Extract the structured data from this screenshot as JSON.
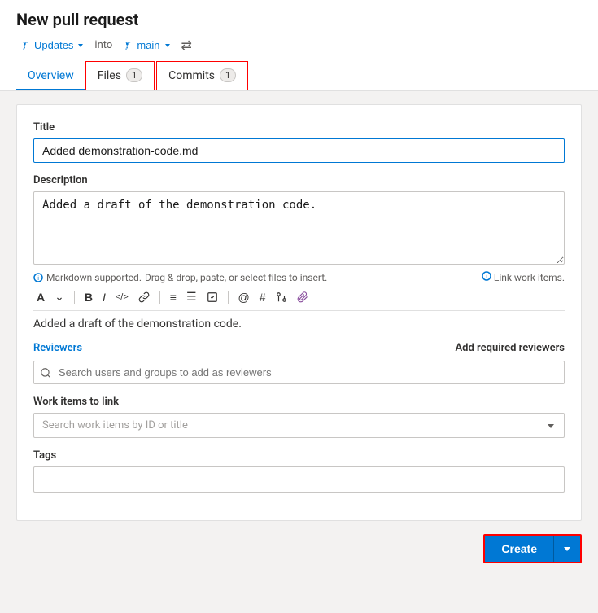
{
  "page": {
    "title": "New pull request"
  },
  "branch_row": {
    "source_icon": "branch-icon",
    "source_label": "Updates",
    "into_text": "into",
    "target_icon": "branch-icon",
    "target_label": "main",
    "swap_label": "⇄"
  },
  "tabs": [
    {
      "id": "overview",
      "label": "Overview",
      "badge": null,
      "active": true,
      "highlighted": false
    },
    {
      "id": "files",
      "label": "Files",
      "badge": "1",
      "active": false,
      "highlighted": true
    },
    {
      "id": "commits",
      "label": "Commits",
      "badge": "1",
      "active": false,
      "highlighted": true
    }
  ],
  "form": {
    "title_label": "Title",
    "title_value": "Added demonstration-code.md",
    "description_label": "Description",
    "description_value": "Added a draft of the demonstration code.",
    "markdown_hint": "Markdown supported.",
    "drag_hint": "Drag & drop, paste, or select files to insert.",
    "link_work_items": "Link work items.",
    "toolbar_buttons": [
      {
        "id": "format",
        "label": "A",
        "title": "Format"
      },
      {
        "id": "chevron",
        "label": "⌄",
        "title": "More"
      },
      {
        "id": "bold",
        "label": "B",
        "title": "Bold"
      },
      {
        "id": "italic",
        "label": "I",
        "title": "Italic"
      },
      {
        "id": "code",
        "label": "</>",
        "title": "Code"
      },
      {
        "id": "link",
        "label": "🔗",
        "title": "Link"
      },
      {
        "id": "ordered-list",
        "label": "≡",
        "title": "Ordered list"
      },
      {
        "id": "unordered-list",
        "label": "☰",
        "title": "Unordered list"
      },
      {
        "id": "task-list",
        "label": "☑",
        "title": "Task list"
      },
      {
        "id": "mention",
        "label": "@",
        "title": "Mention"
      },
      {
        "id": "hash",
        "label": "#",
        "title": "Hash"
      },
      {
        "id": "pr",
        "label": "⑂",
        "title": "Pull request"
      },
      {
        "id": "attachment",
        "label": "📎",
        "title": "Attachment"
      }
    ],
    "preview_text": "Added a draft of the demonstration code.",
    "reviewers_label": "Reviewers",
    "add_reviewers_label": "Add required reviewers",
    "reviewers_placeholder": "Search users and groups to add as reviewers",
    "work_items_label": "Work items to link",
    "work_items_placeholder": "Search work items by ID or title",
    "tags_label": "Tags"
  },
  "footer": {
    "create_label": "Create"
  }
}
